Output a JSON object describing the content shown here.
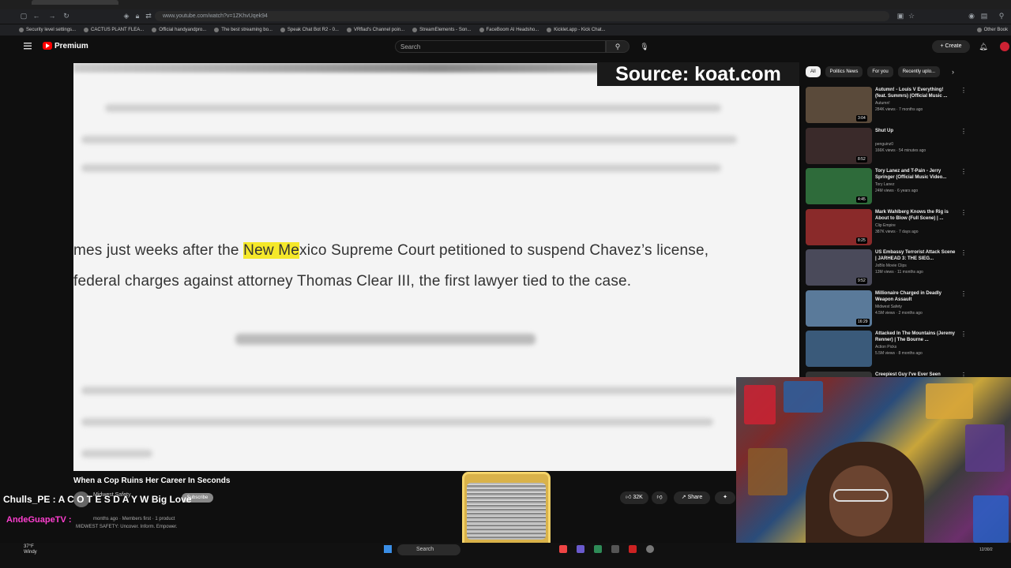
{
  "browser": {
    "url": "www.youtube.com/watch?v=1ZKhvUqek94",
    "bookmarks": [
      "Security level settings...",
      "CACTUS PLANT FLEA...",
      "Official handyandpro...",
      "The best streaming bo...",
      "Speak Chat Bot R2 - 0...",
      "VRflad's Channel poin...",
      "StreamElements - Son...",
      "FaceBoom AI Headsho...",
      "Kicklet.app - Kick Chat...",
      "Other Book"
    ]
  },
  "header": {
    "logo_text": "Premium",
    "search_placeholder": "Search",
    "create_label": "+ Create"
  },
  "player": {
    "source_tag": "Source: koat.com",
    "article": {
      "line1_pre": "mes just weeks after the ",
      "line1_hl": "New Me",
      "line1_post": "xico Supreme Court petitioned to suspend Chavez’s license,",
      "line2": "federal charges against attorney Thomas Clear III, the first lawyer tied to the case."
    }
  },
  "video": {
    "title": "When a Cop Ruins Her Career In Seconds",
    "channel": "Midwest Safety",
    "subscribe_label": "Subscribe",
    "meta": "months ago  ·  Members first  ·  1 product",
    "description": "MIDWEST SAFETY: Uncover. Inform. Empower.",
    "likes": "32K",
    "share_label": "Share"
  },
  "chat": {
    "msg1_user": "Chulls_PE :",
    "msg1_text": " A C O T E S D A Y W Big Love",
    "msg2_user": "AndeGuapeTV :"
  },
  "sidebar": {
    "chips": [
      "All",
      "Politics News",
      "For you",
      "Recently uplo..."
    ],
    "items": [
      {
        "title": "Autumn! - Louis V Everything! (feat. Summrs) (Official Music ...",
        "channel": "Autumn!",
        "meta": "284K views · 7 months ago",
        "duration": "3:04",
        "color": "#5a4a3a"
      },
      {
        "title": "Shut Up",
        "channel": "penguinz0",
        "meta": "166K views · 54 minutes ago",
        "duration": "8:52",
        "color": "#3a2a2a"
      },
      {
        "title": "Tory Lanez and T-Pain - Jerry Springer (Official Music Video...",
        "channel": "Tory Lanez",
        "meta": "24M views · 6 years ago",
        "duration": "4:45",
        "color": "#2e6b3a"
      },
      {
        "title": "Mark Wahlberg Knows the Rig is About to Blow (Full Scene) | ...",
        "channel": "Clip Empire",
        "meta": "387K views · 7 days ago",
        "duration": "8:25",
        "color": "#8a2a2a"
      },
      {
        "title": "US Embassy Terrorist Attack Scene | JARHEAD 3: THE SIEG...",
        "channel": "JoBlo Movie Clips",
        "meta": "13M views · 11 months ago",
        "duration": "9:52",
        "color": "#4a4a5a"
      },
      {
        "title": "Millionaire Charged in Deadly Weapon Assault",
        "channel": "Midwest Safety",
        "meta": "4.5M views · 2 months ago",
        "duration": "16:29",
        "color": "#5a7a9a"
      },
      {
        "title": "Attacked In The Mountains (Jeremy Renner) | The Bourne ...",
        "channel": "Action Picks",
        "meta": "5.5M views · 8 months ago",
        "duration": "",
        "color": "#3a5a7a"
      },
      {
        "title": "Creepiest Guy I've Ever Seen",
        "channel": "",
        "meta": "",
        "duration": "",
        "color": "#333"
      }
    ]
  },
  "taskbar": {
    "weather_temp": "37°F",
    "weather_desc": "Windy",
    "search_label": "Search",
    "clock": "12/30/2"
  }
}
